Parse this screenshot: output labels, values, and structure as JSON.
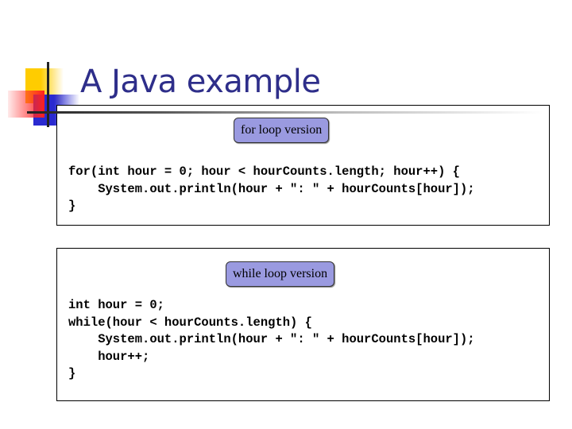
{
  "slide": {
    "title": "A Java example",
    "colors": {
      "title": "#2e2e8a",
      "label_fill": "#9a9ae0"
    }
  },
  "for_box": {
    "label": "for loop version",
    "code": [
      "for(int hour = 0; hour < hourCounts.length; hour++) {",
      "    System.out.println(hour + \": \" + hourCounts[hour]);",
      "}"
    ]
  },
  "while_box": {
    "label": "while loop version",
    "code": [
      "int hour = 0;",
      "while(hour < hourCounts.length) {",
      "    System.out.println(hour + \": \" + hourCounts[hour]);",
      "    hour++;",
      "}"
    ]
  }
}
